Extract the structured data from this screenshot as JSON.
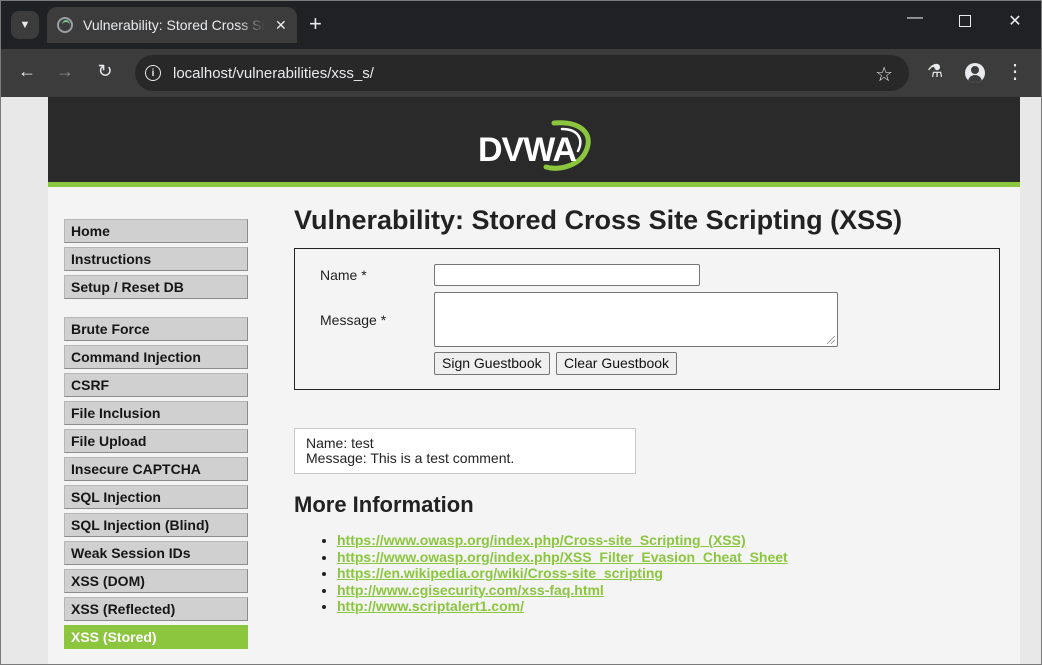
{
  "browser": {
    "tab_title": "Vulnerability: Stored Cross Site Scripting (XSS)",
    "tab_close": "✕",
    "new_tab": "+",
    "url": "localhost/vulnerabilities/xss_s/"
  },
  "header": {
    "logo_text": "DVWA",
    "logo_color": "#8cc63f"
  },
  "menu": {
    "groups": [
      [
        "Home",
        "Instructions",
        "Setup / Reset DB"
      ],
      [
        "Brute Force",
        "Command Injection",
        "CSRF",
        "File Inclusion",
        "File Upload",
        "Insecure CAPTCHA",
        "SQL Injection",
        "SQL Injection (Blind)",
        "Weak Session IDs",
        "XSS (DOM)",
        "XSS (Reflected)",
        "XSS (Stored)"
      ]
    ],
    "selected": "XSS (Stored)"
  },
  "main": {
    "title": "Vulnerability: Stored Cross Site Scripting (XSS)",
    "form": {
      "name_label": "Name *",
      "message_label": "Message *",
      "name_value": "",
      "message_value": "",
      "sign_button": "Sign Guestbook",
      "clear_button": "Clear Guestbook"
    },
    "comment": {
      "name_line": "Name: test",
      "message_line": "Message: This is a test comment."
    },
    "more_info_title": "More Information",
    "links": [
      "https://www.owasp.org/index.php/Cross-site_Scripting_(XSS)",
      "https://www.owasp.org/index.php/XSS_Filter_Evasion_Cheat_Sheet",
      "https://en.wikipedia.org/wiki/Cross-site_scripting",
      "http://www.cgisecurity.com/xss-faq.html",
      "http://www.scriptalert1.com/"
    ]
  },
  "colors": {
    "accent": "#8cc63f",
    "header_bg": "#2a2a2a",
    "page_bg": "#f4f4f4"
  }
}
